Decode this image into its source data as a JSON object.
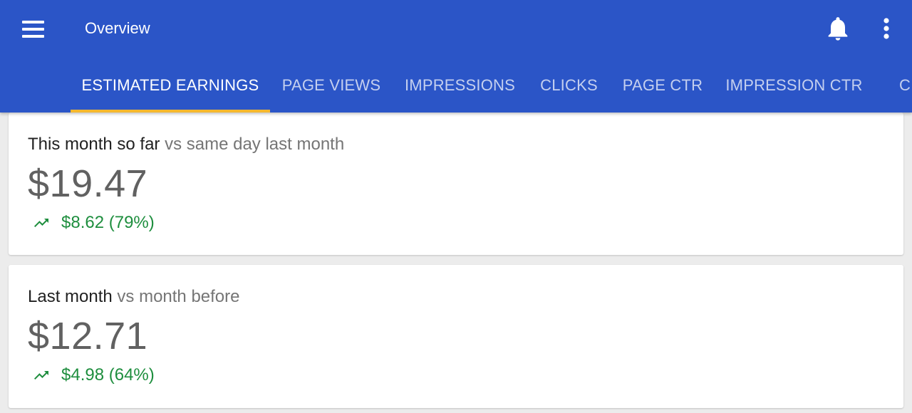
{
  "app_bar": {
    "title": "Overview",
    "menu_icon": "hamburger-menu-icon",
    "notifications_icon": "bell-icon",
    "more_icon": "more-vert-icon",
    "background_color": "#2b55c7"
  },
  "tabs": [
    {
      "label": "ESTIMATED EARNINGS",
      "active": true
    },
    {
      "label": "PAGE VIEWS",
      "active": false
    },
    {
      "label": "IMPRESSIONS",
      "active": false
    },
    {
      "label": "CLICKS",
      "active": false
    },
    {
      "label": "PAGE CTR",
      "active": false
    },
    {
      "label": "IMPRESSION CTR",
      "active": false
    },
    {
      "label": "CI",
      "active": false
    }
  ],
  "tab_indicator_color": "#f5b82e",
  "cards": [
    {
      "title": "This month so far",
      "comparison": "vs same day last month",
      "amount": "$19.47",
      "change": "$8.62 (79%)",
      "trend_icon": "trending-up-icon"
    },
    {
      "title": "Last month",
      "comparison": "vs month before",
      "amount": "$12.71",
      "change": "$4.98 (64%)",
      "trend_icon": "trending-up-icon"
    }
  ],
  "positive_change_color": "#1e8e3e"
}
